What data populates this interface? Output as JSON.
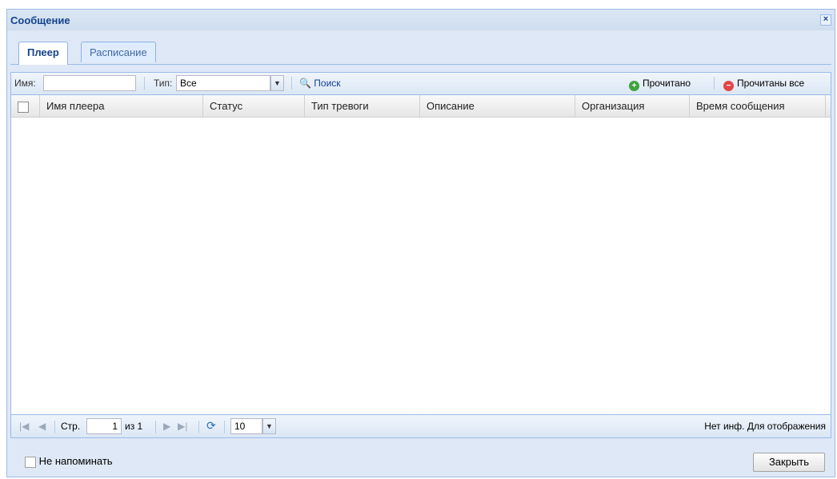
{
  "window": {
    "title": "Сообщение",
    "close_glyph": "×"
  },
  "tabs": [
    {
      "label": "Плеер",
      "active": true
    },
    {
      "label": "Расписание",
      "active": false
    }
  ],
  "toolbar": {
    "name_label": "Имя:",
    "name_value": "",
    "type_label": "Тип:",
    "type_value": "Все",
    "search_label": "Поиск",
    "read_label": "Прочитано",
    "read_all_label": "Прочитаны все"
  },
  "grid": {
    "columns": [
      "Имя плеера",
      "Статус",
      "Тип тревоги",
      "Описание",
      "Организация",
      "Время сообщения"
    ],
    "rows": []
  },
  "paging": {
    "page_label": "Стр.",
    "page_value": "1",
    "of_label": "из 1",
    "page_size": "10",
    "status_text": "Нет инф. Для отображения"
  },
  "footer": {
    "dont_remind_label": "Не напоминать",
    "close_label": "Закрыть"
  },
  "colors": {
    "accent": "#15428b",
    "border": "#99bbe8",
    "green": "#3fa33f",
    "red": "#e04848"
  }
}
